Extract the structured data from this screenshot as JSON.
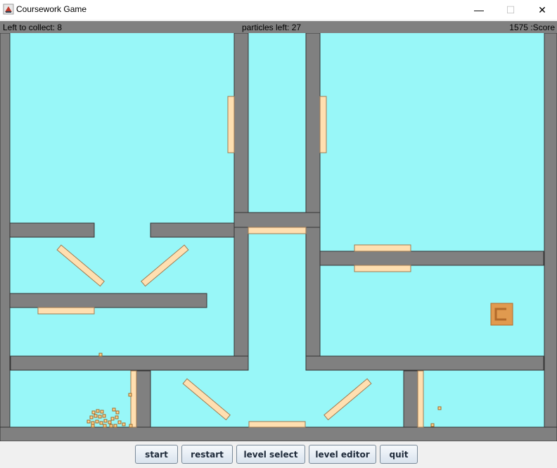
{
  "window": {
    "title": "Coursework Game",
    "minimize_glyph": "—",
    "maximize_glyph": "☐",
    "close_glyph": "✕"
  },
  "hud": {
    "left_to_collect": "Left to collect: 8",
    "particles_left": "particles left: 27",
    "score": "1575 :Score"
  },
  "buttons": {
    "start": "start",
    "restart": "restart",
    "level_select": "level select",
    "level_editor": "level editor",
    "quit": "quit"
  },
  "colors": {
    "background": "#98f7f8",
    "wall": "#808080",
    "paddle": "#ffdfb0",
    "goal": "#e09a4f",
    "particle": "#ffd08a"
  },
  "icons": {
    "app": "java-coffee-icon",
    "goal": "collection-bucket-icon",
    "particle": "particle-square-icon"
  }
}
